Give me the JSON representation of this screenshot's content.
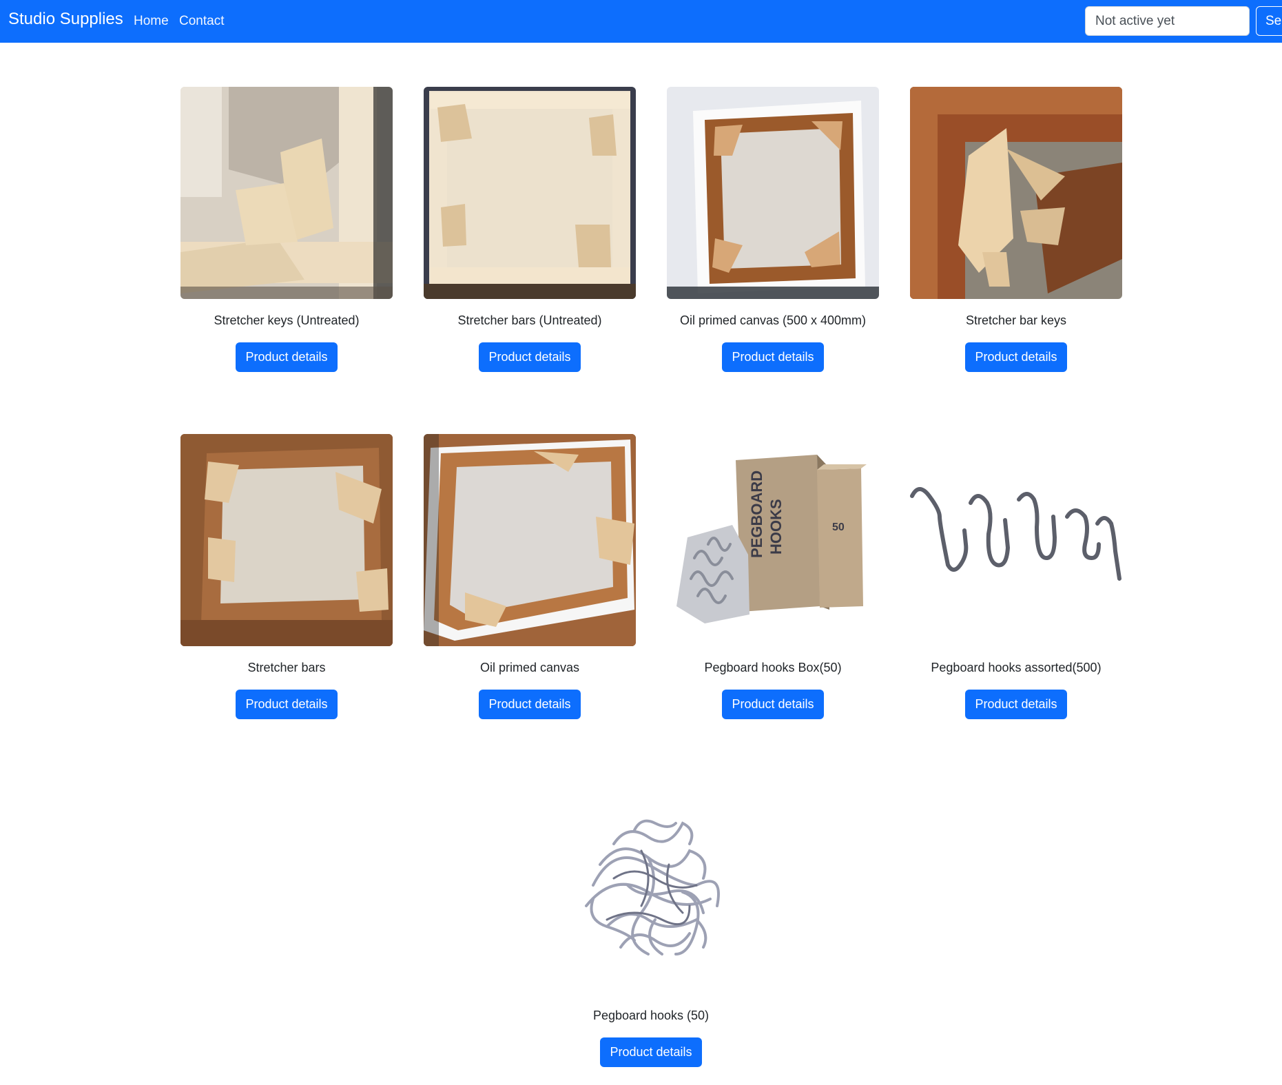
{
  "navbar": {
    "brand": "Studio Supplies",
    "links": [
      "Home",
      "Contact"
    ],
    "search_placeholder": "Not active yet",
    "search_button": "Search"
  },
  "products": [
    {
      "name": "Stretcher keys (Untreated)",
      "button": "Product details",
      "image": "stretcher-keys-photo"
    },
    {
      "name": "Stretcher bars (Untreated)",
      "button": "Product details",
      "image": "stretcher-bars-photo"
    },
    {
      "name": "Oil primed canvas (500 x 400mm)",
      "button": "Product details",
      "image": "primed-canvas-photo"
    },
    {
      "name": "Stretcher bar keys",
      "button": "Product details",
      "image": "stretcher-bar-keys-photo"
    },
    {
      "name": "Stretcher bars",
      "button": "Product details",
      "image": "stretcher-bars-frame-photo"
    },
    {
      "name": "Oil primed canvas",
      "button": "Product details",
      "image": "oil-primed-canvas-photo"
    },
    {
      "name": "Pegboard hooks Box(50)",
      "button": "Product details",
      "image": "pegboard-hooks-box-photo"
    },
    {
      "name": "Pegboard hooks assorted(500)",
      "button": "Product details",
      "image": "pegboard-hooks-assorted-photo"
    },
    {
      "name": "Pegboard hooks (50)",
      "button": "Product details",
      "image": "pegboard-hooks-pile-photo"
    }
  ],
  "box_print": {
    "line1": "PEGBOARD",
    "line2": "HOOKS",
    "count": "50"
  },
  "colors": {
    "primary": "#0d6efd",
    "text": "#212529",
    "background": "#ffffff"
  }
}
